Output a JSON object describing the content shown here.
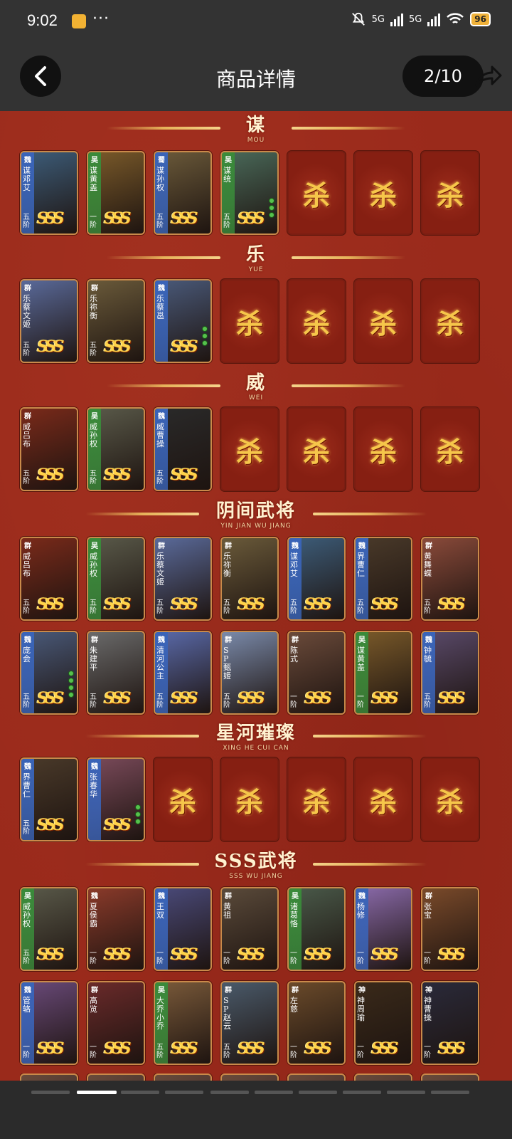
{
  "status_bar": {
    "time": "9:02",
    "more": "···",
    "net1": "5G",
    "net2": "5G",
    "battery": "96"
  },
  "header": {
    "title": "商品详情",
    "pager": "2/10"
  },
  "sections": [
    {
      "title": "谋",
      "subtitle": "MOU"
    },
    {
      "title": "乐",
      "subtitle": "YUE"
    },
    {
      "title": "威",
      "subtitle": "WEI"
    },
    {
      "title": "阴间武将",
      "subtitle": "YIN JIAN WU JIANG"
    },
    {
      "title": "星河璀璨",
      "subtitle": "XING HE CUI CAN"
    },
    {
      "title": "SSS武将",
      "subtitle": "SSS WU JIANG"
    }
  ],
  "empty_card_glyph": "杀",
  "sss_badge": "SSS",
  "cards": {
    "mou": [
      {
        "camp": "魏",
        "name": "谋邓艾",
        "rank": "五阶",
        "dots": 0,
        "color": "#3a64b8",
        "art": "#3d5d7a"
      },
      {
        "camp": "吴",
        "name": "谋黄盖",
        "rank": "一阶",
        "dots": 0,
        "color": "#3a8a3a",
        "art": "#7a5a2a"
      },
      {
        "camp": "蜀",
        "name": "谋孙权",
        "rank": "五阶",
        "dots": 0,
        "color": "#3a64b8",
        "art": "#6b5a3a"
      },
      {
        "camp": "吴",
        "name": "谋统",
        "rank": "五阶",
        "dots": 3,
        "color": "#3a8a3a",
        "art": "#4a6a5a"
      }
    ],
    "yue": [
      {
        "camp": "群",
        "name": "乐蔡文姬",
        "rank": "五阶",
        "dots": 0,
        "color": "#888",
        "art": "#5a6a9a"
      },
      {
        "camp": "群",
        "name": "乐祢衡",
        "rank": "五阶",
        "dots": 0,
        "color": "#888",
        "art": "#6a5a3a"
      },
      {
        "camp": "魏",
        "name": "乐蔡邕",
        "rank": "",
        "dots": 3,
        "color": "#3a64b8",
        "art": "#4a5a7a"
      }
    ],
    "wei": [
      {
        "camp": "群",
        "name": "威吕布",
        "rank": "五阶",
        "dots": 0,
        "color": "#888",
        "art": "#7a2a1a"
      },
      {
        "camp": "吴",
        "name": "威孙权",
        "rank": "五阶",
        "dots": 0,
        "color": "#3a8a3a",
        "art": "#5a5a4a"
      },
      {
        "camp": "魏",
        "name": "威曹操",
        "rank": "五阶",
        "dots": 0,
        "color": "#3a64b8",
        "art": "#2a2a2a"
      }
    ],
    "yinjian1": [
      {
        "camp": "群",
        "name": "威吕布",
        "rank": "五阶",
        "dots": 0,
        "color": "#888",
        "art": "#7a2a1a"
      },
      {
        "camp": "吴",
        "name": "威孙权",
        "rank": "五阶",
        "dots": 0,
        "color": "#3a8a3a",
        "art": "#5a5a4a"
      },
      {
        "camp": "群",
        "name": "乐蔡文姬",
        "rank": "五阶",
        "dots": 0,
        "color": "#888",
        "art": "#5a6a9a"
      },
      {
        "camp": "群",
        "name": "乐祢衡",
        "rank": "五阶",
        "dots": 0,
        "color": "#888",
        "art": "#6a5a3a"
      },
      {
        "camp": "魏",
        "name": "谋邓艾",
        "rank": "五阶",
        "dots": 0,
        "color": "#3a64b8",
        "art": "#3d5d7a"
      },
      {
        "camp": "魏",
        "name": "界曹仁",
        "rank": "五阶",
        "dots": 0,
        "color": "#3a64b8",
        "art": "#4a3a2a"
      },
      {
        "camp": "群",
        "name": "黄舞蝶",
        "rank": "五阶",
        "dots": 0,
        "color": "#888",
        "art": "#8a4a3a"
      }
    ],
    "yinjian2": [
      {
        "camp": "魏",
        "name": "庞会",
        "rank": "五阶",
        "dots": 4,
        "color": "#3a64b8",
        "art": "#4a5a7a"
      },
      {
        "camp": "群",
        "name": "朱建平",
        "rank": "五阶",
        "dots": 0,
        "color": "#888",
        "art": "#6a6a6a"
      },
      {
        "camp": "魏",
        "name": "清河公主",
        "rank": "五阶",
        "dots": 0,
        "color": "#3a64b8",
        "art": "#5a6aaa"
      },
      {
        "camp": "群",
        "name": "SP甄姬",
        "rank": "五阶",
        "dots": 0,
        "color": "#888",
        "art": "#7a8aaa"
      },
      {
        "camp": "群",
        "name": "陈式",
        "rank": "一阶",
        "dots": 0,
        "color": "#888",
        "art": "#6a4a3a"
      },
      {
        "camp": "吴",
        "name": "谋黄盖",
        "rank": "一阶",
        "dots": 0,
        "color": "#3a8a3a",
        "art": "#7a5a2a"
      },
      {
        "camp": "魏",
        "name": "钟毓",
        "rank": "五阶",
        "dots": 0,
        "color": "#3a64b8",
        "art": "#5a4a6a"
      }
    ],
    "xinghe": [
      {
        "camp": "魏",
        "name": "界曹仁",
        "rank": "五阶",
        "dots": 0,
        "color": "#3a64b8",
        "art": "#4a3a2a"
      },
      {
        "camp": "魏",
        "name": "张春华",
        "rank": "",
        "dots": 3,
        "color": "#3a64b8",
        "art": "#7a4a5a"
      }
    ],
    "sss1": [
      {
        "camp": "吴",
        "name": "威孙权",
        "rank": "五阶",
        "dots": 0,
        "color": "#3a8a3a",
        "art": "#5a5a4a"
      },
      {
        "camp": "魏",
        "name": "夏侯霸",
        "rank": "一阶",
        "dots": 0,
        "color": "#888",
        "art": "#8a3a2a"
      },
      {
        "camp": "魏",
        "name": "王双",
        "rank": "一阶",
        "dots": 0,
        "color": "#3a64b8",
        "art": "#4a4a7a"
      },
      {
        "camp": "群",
        "name": "黄祖",
        "rank": "一阶",
        "dots": 0,
        "color": "#888",
        "art": "#5a4a3a"
      },
      {
        "camp": "吴",
        "name": "诸葛恪",
        "rank": "一阶",
        "dots": 0,
        "color": "#3a8a3a",
        "art": "#4a5a4a"
      },
      {
        "camp": "魏",
        "name": "杨修",
        "rank": "一阶",
        "dots": 0,
        "color": "#3a64b8",
        "art": "#8a6aaa"
      },
      {
        "camp": "群",
        "name": "张宝",
        "rank": "一阶",
        "dots": 0,
        "color": "#888",
        "art": "#7a4a2a"
      }
    ],
    "sss2": [
      {
        "camp": "魏",
        "name": "管辂",
        "rank": "一阶",
        "dots": 0,
        "color": "#3a64b8",
        "art": "#6a4a7a"
      },
      {
        "camp": "群",
        "name": "高览",
        "rank": "一阶",
        "dots": 0,
        "color": "#888",
        "art": "#6a2a2a"
      },
      {
        "camp": "吴",
        "name": "大乔小乔",
        "rank": "五阶",
        "dots": 0,
        "color": "#3a8a3a",
        "art": "#7a5a3a"
      },
      {
        "camp": "群",
        "name": "SP赵云",
        "rank": "五阶",
        "dots": 0,
        "color": "#888",
        "art": "#4a5a6a"
      },
      {
        "camp": "群",
        "name": "左慈",
        "rank": "一阶",
        "dots": 0,
        "color": "#888",
        "art": "#6a4a2a"
      },
      {
        "camp": "神",
        "name": "神周瑜",
        "rank": "一阶",
        "dots": 0,
        "color": "#888",
        "art": "#3a2a1a"
      },
      {
        "camp": "神",
        "name": "神曹操",
        "rank": "一阶",
        "dots": 0,
        "color": "#888",
        "art": "#2a2a3a"
      }
    ]
  }
}
